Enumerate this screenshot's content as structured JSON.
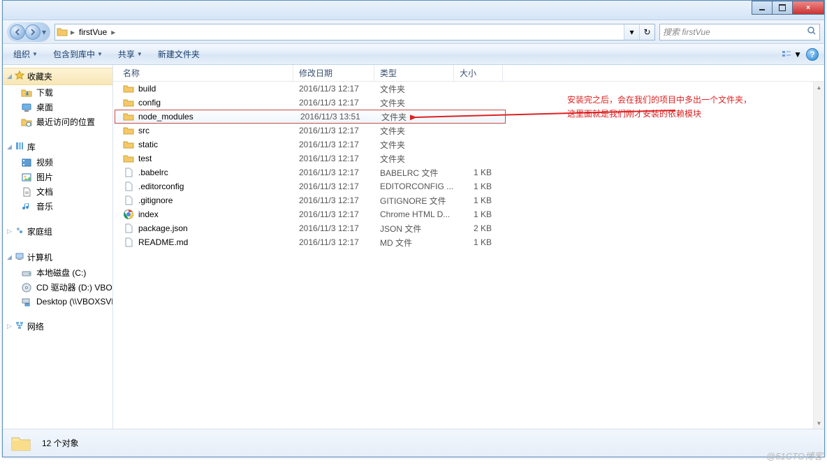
{
  "window": {
    "min": "minimize",
    "max": "maximize",
    "close": "×"
  },
  "breadcrumb": {
    "seg1": "firstVue"
  },
  "address": {
    "dropdown": "▾",
    "refresh": "↻"
  },
  "search": {
    "placeholder": "搜索 firstVue"
  },
  "toolbar": {
    "organize": "组织",
    "include": "包含到库中",
    "share": "共享",
    "newfolder": "新建文件夹"
  },
  "columns": {
    "name": "名称",
    "date": "修改日期",
    "type": "类型",
    "size": "大小"
  },
  "sidebar": {
    "favorites": "收藏夹",
    "downloads": "下载",
    "desktop": "桌面",
    "recent": "最近访问的位置",
    "libraries": "库",
    "videos": "视频",
    "pictures": "图片",
    "documents": "文档",
    "music": "音乐",
    "homegroup": "家庭组",
    "computer": "计算机",
    "localdisk": "本地磁盘 (C:)",
    "cddrive": "CD 驱动器 (D:) VBOXADDITIONS",
    "desktop_net": "Desktop (\\\\VBOXSVR)",
    "network": "网络"
  },
  "files": [
    {
      "name": "build",
      "date": "2016/11/3 12:17",
      "type": "文件夹",
      "size": "",
      "kind": "folder"
    },
    {
      "name": "config",
      "date": "2016/11/3 12:17",
      "type": "文件夹",
      "size": "",
      "kind": "folder"
    },
    {
      "name": "node_modules",
      "date": "2016/11/3 13:51",
      "type": "文件夹",
      "size": "",
      "kind": "folder",
      "selected": true
    },
    {
      "name": "src",
      "date": "2016/11/3 12:17",
      "type": "文件夹",
      "size": "",
      "kind": "folder"
    },
    {
      "name": "static",
      "date": "2016/11/3 12:17",
      "type": "文件夹",
      "size": "",
      "kind": "folder"
    },
    {
      "name": "test",
      "date": "2016/11/3 12:17",
      "type": "文件夹",
      "size": "",
      "kind": "folder"
    },
    {
      "name": ".babelrc",
      "date": "2016/11/3 12:17",
      "type": "BABELRC 文件",
      "size": "1 KB",
      "kind": "file"
    },
    {
      "name": ".editorconfig",
      "date": "2016/11/3 12:17",
      "type": "EDITORCONFIG ...",
      "size": "1 KB",
      "kind": "file"
    },
    {
      "name": ".gitignore",
      "date": "2016/11/3 12:17",
      "type": "GITIGNORE 文件",
      "size": "1 KB",
      "kind": "file"
    },
    {
      "name": "index",
      "date": "2016/11/3 12:17",
      "type": "Chrome HTML D...",
      "size": "1 KB",
      "kind": "chrome"
    },
    {
      "name": "package.json",
      "date": "2016/11/3 12:17",
      "type": "JSON 文件",
      "size": "2 KB",
      "kind": "file"
    },
    {
      "name": "README.md",
      "date": "2016/11/3 12:17",
      "type": "MD 文件",
      "size": "1 KB",
      "kind": "file"
    }
  ],
  "status": {
    "count": "12 个对象"
  },
  "annotation": {
    "line1": "安装完之后，会在我们的项目中多出一个文件夹，",
    "line2": "这里面就是我们刚才安装的依赖模块"
  },
  "watermark": "@51CTO博客"
}
